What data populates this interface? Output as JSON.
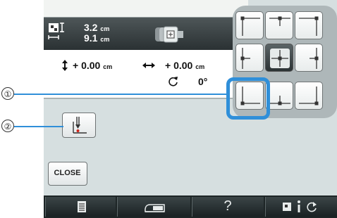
{
  "info": {
    "height_value": "3.2",
    "height_unit": "cm",
    "width_value": "9.1",
    "width_unit": "cm"
  },
  "position": {
    "vertical_value": "+ 0.00",
    "vertical_unit": "cm",
    "horizontal_value": "+ 0.00",
    "horizontal_unit": "cm",
    "angle_value": "0°"
  },
  "buttons": {
    "close_label": "CLOSE"
  },
  "callouts": {
    "one": "①",
    "two": "②"
  },
  "bottom_bar": {
    "help_label": "?"
  },
  "colors": {
    "highlight": "#2f8fd9",
    "accent_red": "#d0251a"
  },
  "icons": [
    "embroidery-size-icon",
    "frame-icon",
    "up-down-arrow-icon",
    "left-right-arrow-icon",
    "rotate-icon",
    "needle-icon",
    "page-icon",
    "sewing-machine-icon",
    "info-icon",
    "refresh-icon"
  ]
}
